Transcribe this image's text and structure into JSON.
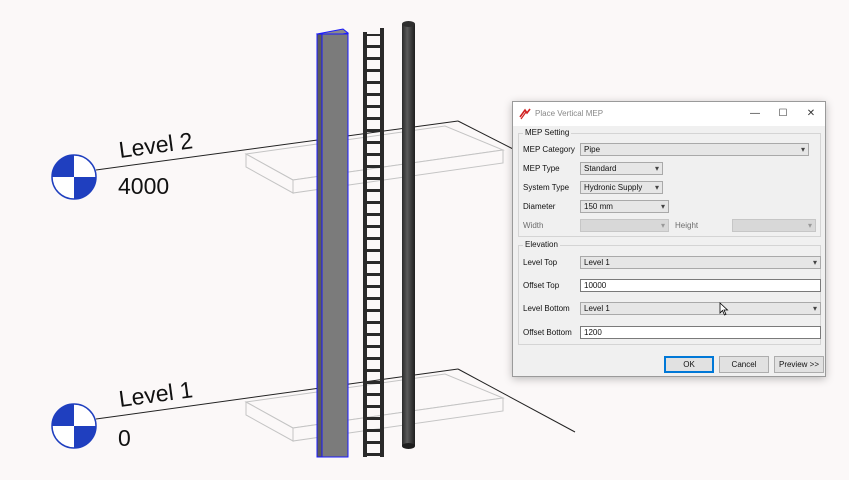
{
  "levels": [
    {
      "name": "Level 2",
      "elevation": "4000"
    },
    {
      "name": "Level 1",
      "elevation": "0"
    }
  ],
  "dialog": {
    "title": "Place Vertical MEP",
    "window_controls": {
      "minimize": "—",
      "maximize": "☐",
      "close": "✕"
    },
    "mep_setting": {
      "group_title": "MEP Setting",
      "category_label": "MEP Category",
      "category_value": "Pipe",
      "type_label": "MEP Type",
      "type_value": "Standard",
      "system_label": "System Type",
      "system_value": "Hydronic Supply",
      "diameter_label": "Diameter",
      "diameter_value": "150 mm",
      "width_label": "Width",
      "width_value": "",
      "height_label": "Height",
      "height_value": ""
    },
    "elevation": {
      "group_title": "Elevation",
      "level_top_label": "Level Top",
      "level_top_value": "Level 1",
      "offset_top_label": "Offset Top",
      "offset_top_value": "10000",
      "level_bottom_label": "Level Bottom",
      "level_bottom_value": "Level 1",
      "offset_bottom_label": "Offset Bottom",
      "offset_bottom_value": "1200"
    },
    "buttons": {
      "ok": "OK",
      "cancel": "Cancel",
      "preview": "Preview >>"
    }
  },
  "colors": {
    "selection": "#1a1aff",
    "level_marker": "#1f3fbf",
    "column": "#777777",
    "pipe": "#3a3a3a"
  },
  "icons": {
    "dropdown": "▾"
  }
}
